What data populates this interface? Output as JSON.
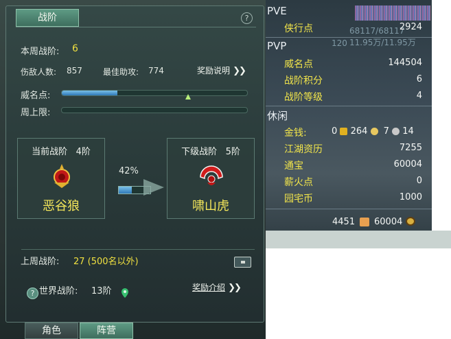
{
  "panel": {
    "title": "战阶",
    "help_glyph": "?",
    "weekly_rank_label": "本周战阶:",
    "weekly_rank_value": "6",
    "enemies_label": "伤敌人数:",
    "enemies_value": "857",
    "assist_label": "最佳助攻:",
    "assist_value": "774",
    "reward_info_label": "奖励说明",
    "fame_label": "威名点:",
    "fame_progress": 0.3,
    "fame_marker": 0.68,
    "weekly_cap_label": "周上限:",
    "weekly_cap_progress": 0,
    "current": {
      "header": "当前战阶",
      "tier": "4阶",
      "name": "恶谷狼",
      "icon": "wolf-emblem-icon"
    },
    "next": {
      "header": "下级战阶",
      "tier": "5阶",
      "name": "啸山虎",
      "icon": "tiger-emblem-icon"
    },
    "progress_percent": "42%",
    "progress_value": 0.42,
    "last_week_label": "上周战阶:",
    "last_week_value": "27 (500名以外)",
    "world_label": "世界战阶:",
    "world_value": "13阶",
    "reward_intro_label": "奖励介绍",
    "chevrons": "❯❯"
  },
  "bottom_tabs": [
    {
      "label": "角色",
      "active": false
    },
    {
      "label": "阵营",
      "active": true
    }
  ],
  "currency": {
    "pve_title": "PVE",
    "pve_rows": [
      {
        "label": "侠行点",
        "value": "2924"
      }
    ],
    "pvp_title": "PVP",
    "pvp_rows": [
      {
        "label": "威名点",
        "value": "144504"
      },
      {
        "label": "战阶积分",
        "value": "6"
      },
      {
        "label": "战阶等级",
        "value": "4"
      }
    ],
    "leisure_title": "休闲",
    "money": {
      "label": "金钱:",
      "gold": "0",
      "silver": "264",
      "copper": "7",
      "other": "14"
    },
    "leisure_rows": [
      {
        "label": "江湖资历",
        "value": "7255"
      },
      {
        "label": "通宝",
        "value": "60004"
      },
      {
        "label": "薪火点",
        "value": "0"
      },
      {
        "label": "园宅币",
        "value": "1000"
      }
    ],
    "bottom_left": "4451",
    "bottom_right": "60004"
  },
  "background_text": {
    "hp_readout": "68117/68117",
    "mp_readout": "11.95万/11.95万",
    "level": "120"
  },
  "colors": {
    "accent_yellow": "#f0e040",
    "tab_green": "#5e9a84",
    "bar_blue": "#2f78b8"
  }
}
